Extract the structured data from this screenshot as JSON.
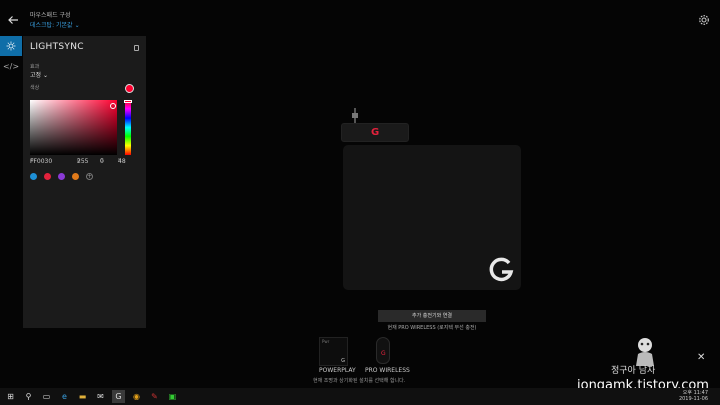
{
  "header": {
    "crumb_top": "마우스패드 구성",
    "profile": "데스크탑: 기본값",
    "chevron": "⌄"
  },
  "panel": {
    "title": "LIGHTSYNC",
    "effect_label": "효과",
    "effect_value": "고정",
    "effect_chevron": "⌄",
    "color_label": "색상",
    "hex_tag": "#",
    "hex": "FF0030",
    "r_tag": "R",
    "r": "255",
    "g_tag": "G",
    "g": "0",
    "b_tag": "B",
    "b": "48",
    "add_preset": "+",
    "current_color": "#FF0030",
    "presets": [
      "#1e90d6",
      "#e3223c",
      "#8a3ad6",
      "#e07a1a"
    ]
  },
  "main": {
    "action_button": "추가 충전기와 연결",
    "status_line": "현재 PRO WIRELESS (로지텍 무선 충전)"
  },
  "devices": {
    "pad_tag": "Pwr",
    "pad_logo": "G",
    "pad_label": "POWERPLAY",
    "mouse_label": "PRO WIRELESS",
    "hint": "현재 조명과 상기화된 설치를 선택해 합니다."
  },
  "watermark": {
    "line1": "정구아 남자",
    "line2": "jongamk.tistory.com"
  },
  "taskbar": {
    "time": "오후 11:47",
    "date": "2019-11-06",
    "items": [
      "⊞",
      "⚲",
      "▭",
      "e",
      "▬",
      "✉",
      "G",
      "◉",
      "✎",
      "▣"
    ]
  },
  "colors": {
    "accent": "#0f6ea8",
    "brand_red": "#e3223c"
  }
}
